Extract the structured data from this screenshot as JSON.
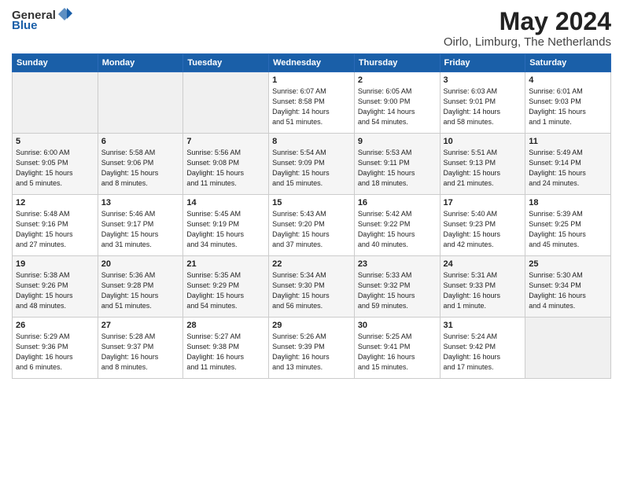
{
  "header": {
    "logo_general": "General",
    "logo_blue": "Blue",
    "title": "May 2024",
    "subtitle": "Oirlo, Limburg, The Netherlands"
  },
  "days_of_week": [
    "Sunday",
    "Monday",
    "Tuesday",
    "Wednesday",
    "Thursday",
    "Friday",
    "Saturday"
  ],
  "weeks": [
    [
      {
        "day": "",
        "info": ""
      },
      {
        "day": "",
        "info": ""
      },
      {
        "day": "",
        "info": ""
      },
      {
        "day": "1",
        "info": "Sunrise: 6:07 AM\nSunset: 8:58 PM\nDaylight: 14 hours\nand 51 minutes."
      },
      {
        "day": "2",
        "info": "Sunrise: 6:05 AM\nSunset: 9:00 PM\nDaylight: 14 hours\nand 54 minutes."
      },
      {
        "day": "3",
        "info": "Sunrise: 6:03 AM\nSunset: 9:01 PM\nDaylight: 14 hours\nand 58 minutes."
      },
      {
        "day": "4",
        "info": "Sunrise: 6:01 AM\nSunset: 9:03 PM\nDaylight: 15 hours\nand 1 minute."
      }
    ],
    [
      {
        "day": "5",
        "info": "Sunrise: 6:00 AM\nSunset: 9:05 PM\nDaylight: 15 hours\nand 5 minutes."
      },
      {
        "day": "6",
        "info": "Sunrise: 5:58 AM\nSunset: 9:06 PM\nDaylight: 15 hours\nand 8 minutes."
      },
      {
        "day": "7",
        "info": "Sunrise: 5:56 AM\nSunset: 9:08 PM\nDaylight: 15 hours\nand 11 minutes."
      },
      {
        "day": "8",
        "info": "Sunrise: 5:54 AM\nSunset: 9:09 PM\nDaylight: 15 hours\nand 15 minutes."
      },
      {
        "day": "9",
        "info": "Sunrise: 5:53 AM\nSunset: 9:11 PM\nDaylight: 15 hours\nand 18 minutes."
      },
      {
        "day": "10",
        "info": "Sunrise: 5:51 AM\nSunset: 9:13 PM\nDaylight: 15 hours\nand 21 minutes."
      },
      {
        "day": "11",
        "info": "Sunrise: 5:49 AM\nSunset: 9:14 PM\nDaylight: 15 hours\nand 24 minutes."
      }
    ],
    [
      {
        "day": "12",
        "info": "Sunrise: 5:48 AM\nSunset: 9:16 PM\nDaylight: 15 hours\nand 27 minutes."
      },
      {
        "day": "13",
        "info": "Sunrise: 5:46 AM\nSunset: 9:17 PM\nDaylight: 15 hours\nand 31 minutes."
      },
      {
        "day": "14",
        "info": "Sunrise: 5:45 AM\nSunset: 9:19 PM\nDaylight: 15 hours\nand 34 minutes."
      },
      {
        "day": "15",
        "info": "Sunrise: 5:43 AM\nSunset: 9:20 PM\nDaylight: 15 hours\nand 37 minutes."
      },
      {
        "day": "16",
        "info": "Sunrise: 5:42 AM\nSunset: 9:22 PM\nDaylight: 15 hours\nand 40 minutes."
      },
      {
        "day": "17",
        "info": "Sunrise: 5:40 AM\nSunset: 9:23 PM\nDaylight: 15 hours\nand 42 minutes."
      },
      {
        "day": "18",
        "info": "Sunrise: 5:39 AM\nSunset: 9:25 PM\nDaylight: 15 hours\nand 45 minutes."
      }
    ],
    [
      {
        "day": "19",
        "info": "Sunrise: 5:38 AM\nSunset: 9:26 PM\nDaylight: 15 hours\nand 48 minutes."
      },
      {
        "day": "20",
        "info": "Sunrise: 5:36 AM\nSunset: 9:28 PM\nDaylight: 15 hours\nand 51 minutes."
      },
      {
        "day": "21",
        "info": "Sunrise: 5:35 AM\nSunset: 9:29 PM\nDaylight: 15 hours\nand 54 minutes."
      },
      {
        "day": "22",
        "info": "Sunrise: 5:34 AM\nSunset: 9:30 PM\nDaylight: 15 hours\nand 56 minutes."
      },
      {
        "day": "23",
        "info": "Sunrise: 5:33 AM\nSunset: 9:32 PM\nDaylight: 15 hours\nand 59 minutes."
      },
      {
        "day": "24",
        "info": "Sunrise: 5:31 AM\nSunset: 9:33 PM\nDaylight: 16 hours\nand 1 minute."
      },
      {
        "day": "25",
        "info": "Sunrise: 5:30 AM\nSunset: 9:34 PM\nDaylight: 16 hours\nand 4 minutes."
      }
    ],
    [
      {
        "day": "26",
        "info": "Sunrise: 5:29 AM\nSunset: 9:36 PM\nDaylight: 16 hours\nand 6 minutes."
      },
      {
        "day": "27",
        "info": "Sunrise: 5:28 AM\nSunset: 9:37 PM\nDaylight: 16 hours\nand 8 minutes."
      },
      {
        "day": "28",
        "info": "Sunrise: 5:27 AM\nSunset: 9:38 PM\nDaylight: 16 hours\nand 11 minutes."
      },
      {
        "day": "29",
        "info": "Sunrise: 5:26 AM\nSunset: 9:39 PM\nDaylight: 16 hours\nand 13 minutes."
      },
      {
        "day": "30",
        "info": "Sunrise: 5:25 AM\nSunset: 9:41 PM\nDaylight: 16 hours\nand 15 minutes."
      },
      {
        "day": "31",
        "info": "Sunrise: 5:24 AM\nSunset: 9:42 PM\nDaylight: 16 hours\nand 17 minutes."
      },
      {
        "day": "",
        "info": ""
      }
    ]
  ]
}
